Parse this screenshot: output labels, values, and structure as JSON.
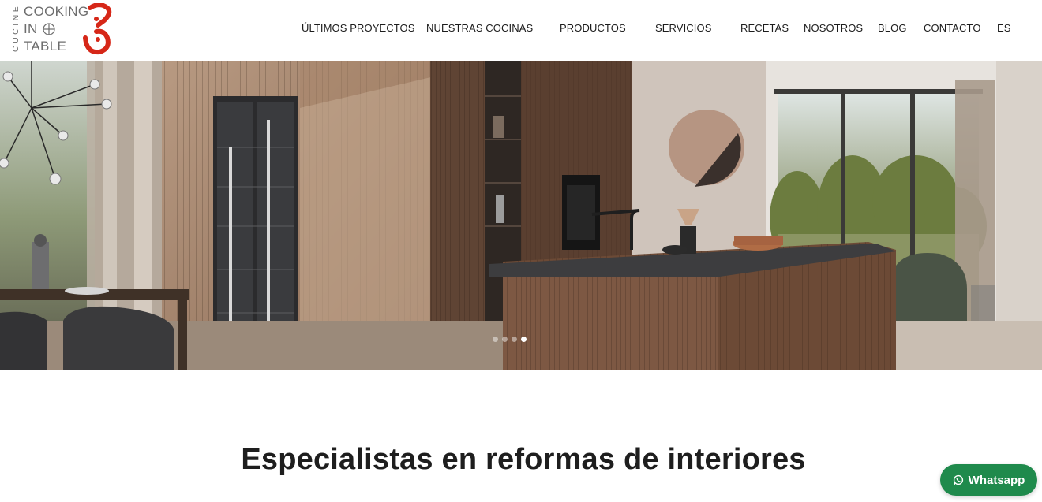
{
  "logo": {
    "vertical": "CUCINE",
    "line1": "COOKING",
    "line2": "IN",
    "line3": "TABLE",
    "brand_color": "#d62718"
  },
  "nav": {
    "items": [
      {
        "label": "ÚLTIMOS PROYECTOS"
      },
      {
        "label": "NUESTRAS COCINAS"
      },
      {
        "label": "PRODUCTOS"
      },
      {
        "label": "SERVICIOS"
      },
      {
        "label": "RECETAS"
      },
      {
        "label": "NOSOTROS"
      },
      {
        "label": "BLOG"
      },
      {
        "label": "CONTACTO"
      },
      {
        "label": "ES"
      }
    ]
  },
  "hero": {
    "slide_count": 4,
    "active_slide": 4
  },
  "section": {
    "title": "Especialistas en reformas de interiores"
  },
  "whatsapp": {
    "label": "Whatsapp",
    "color": "#1f8a4c"
  }
}
